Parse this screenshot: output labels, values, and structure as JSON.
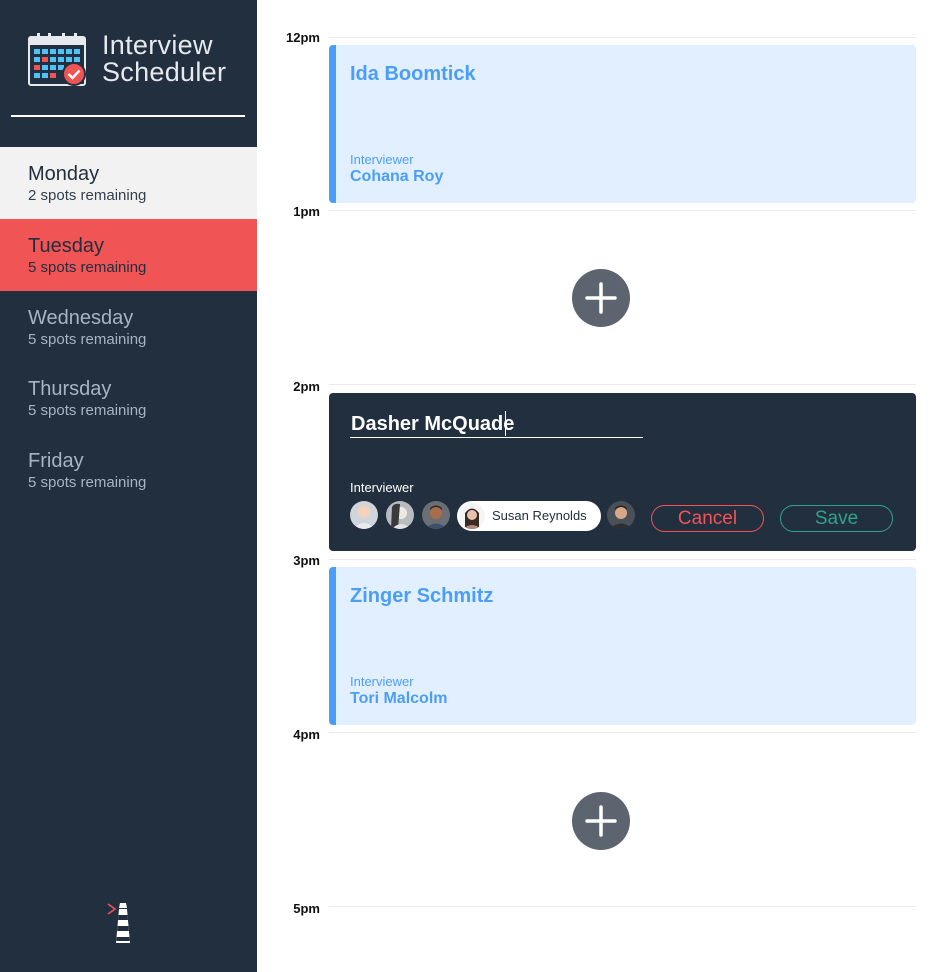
{
  "app": {
    "title_line1": "Interview",
    "title_line2": "Scheduler"
  },
  "sidebar": {
    "days": [
      {
        "name": "Monday",
        "spots": "2 spots remaining",
        "state": "selected"
      },
      {
        "name": "Tuesday",
        "spots": "5 spots remaining",
        "state": "full"
      },
      {
        "name": "Wednesday",
        "spots": "5 spots remaining",
        "state": "normal"
      },
      {
        "name": "Thursday",
        "spots": "5 spots remaining",
        "state": "normal"
      },
      {
        "name": "Friday",
        "spots": "5 spots remaining",
        "state": "normal"
      }
    ]
  },
  "schedule": {
    "hours": [
      "12pm",
      "1pm",
      "2pm",
      "3pm",
      "4pm",
      "5pm"
    ],
    "appointments": [
      {
        "student": "Ida Boomtick",
        "interviewer_label": "Interviewer",
        "interviewer": "Cohana Roy"
      },
      {
        "student": "Zinger Schmitz",
        "interviewer_label": "Interviewer",
        "interviewer": "Tori Malcolm"
      }
    ],
    "form": {
      "student_value": "Dasher McQuade",
      "interviewer_label": "Interviewer",
      "selected_interviewer": "Susan Reynolds",
      "cancel_label": "Cancel",
      "save_label": "Save"
    }
  },
  "colors": {
    "sidebar_bg": "#222f3e",
    "selected_day_bg": "#f2f2f2",
    "full_day_bg": "#f05455",
    "appointment_bg": "#e2efff",
    "appointment_accent": "#4b9ef7",
    "cancel": "#f05455",
    "save": "#2fa38a",
    "add_button": "#5c6470"
  },
  "icons": [
    "calendar-logo-icon",
    "plus-icon",
    "lighthouse-icon"
  ]
}
